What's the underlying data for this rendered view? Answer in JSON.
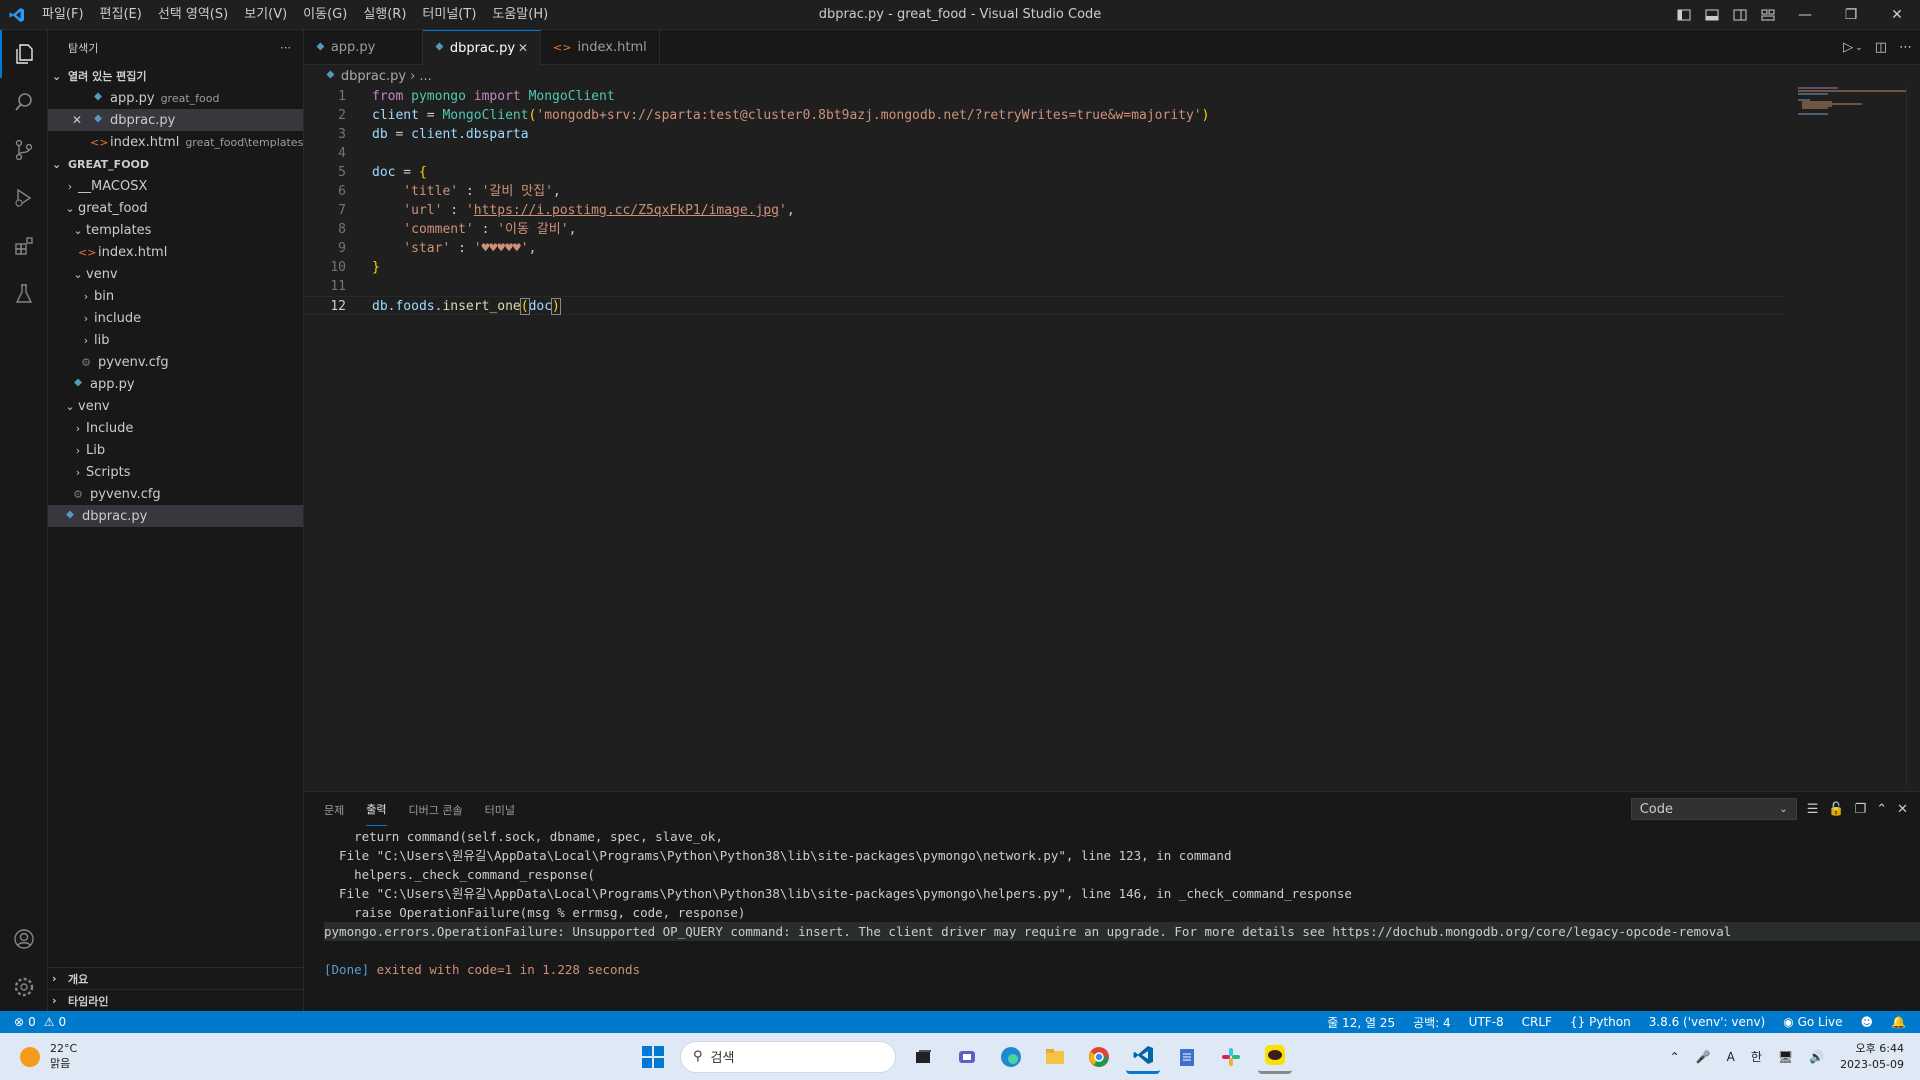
{
  "window": {
    "title": "dbprac.py - great_food - Visual Studio Code"
  },
  "menu": [
    "파일(F)",
    "편집(E)",
    "선택 영역(S)",
    "보기(V)",
    "이동(G)",
    "실행(R)",
    "터미널(T)",
    "도움말(H)"
  ],
  "sidebar": {
    "title": "탐색기",
    "open_editors_label": "열려 있는 편집기",
    "open_editors": [
      {
        "name": "app.py",
        "desc": "great_food"
      },
      {
        "name": "dbprac.py",
        "desc": ""
      },
      {
        "name": "index.html",
        "desc": "great_food\\templates"
      }
    ],
    "project_label": "GREAT_FOOD",
    "tree": [
      "__MACOSX",
      "great_food",
      "templates",
      "index.html",
      "venv",
      "bin",
      "include",
      "lib",
      "pyvenv.cfg",
      "app.py",
      "venv",
      "Include",
      "Lib",
      "Scripts",
      "pyvenv.cfg",
      "dbprac.py"
    ],
    "outline_label": "개요",
    "timeline_label": "타임라인"
  },
  "tabs": [
    {
      "label": "app.py"
    },
    {
      "label": "dbprac.py"
    },
    {
      "label": "index.html"
    }
  ],
  "breadcrumb": {
    "file": "dbprac.py",
    "rest": "..."
  },
  "code": {
    "lines": [
      "1",
      "2",
      "3",
      "4",
      "5",
      "6",
      "7",
      "8",
      "9",
      "10",
      "11",
      "12"
    ],
    "l1_a": "from ",
    "l1_b": "pymongo",
    "l1_c": " import ",
    "l1_d": "MongoClient",
    "l2_a": "client",
    "l2_b": " = ",
    "l2_c": "MongoClient",
    "l2_d": "(",
    "l2_e": "'mongodb+srv://sparta:test@cluster0.8bt9azj.mongodb.net/?retryWrites=true&w=majority'",
    "l2_f": ")",
    "l3_a": "db",
    "l3_b": " = ",
    "l3_c": "client",
    "l3_d": ".dbsparta",
    "l5_a": "doc",
    "l5_b": " = ",
    "l5_c": "{",
    "l6_a": "    'title'",
    "l6_b": " : ",
    "l6_c": "'갈비 맛집'",
    "l6_d": ",",
    "l7_a": "    'url'",
    "l7_b": " : ",
    "l7_c": "'",
    "l7_d": "https://i.postimg.cc/Z5qxFkP1/image.jpg",
    "l7_e": "'",
    "l7_f": ",",
    "l8_a": "    'comment'",
    "l8_b": " : ",
    "l8_c": "'이동 갈비'",
    "l8_d": ",",
    "l9_a": "    'star'",
    "l9_b": " : ",
    "l9_c": "'♥♥♥♥♥'",
    "l9_d": ",",
    "l10_a": "}",
    "l12_a": "db",
    "l12_b": ".foods.",
    "l12_c": "insert_one",
    "l12_d": "(",
    "l12_e": "doc",
    "l12_f": ")"
  },
  "panel": {
    "tabs": [
      "문제",
      "출력",
      "디버그 콘솔",
      "터미널"
    ],
    "select": "Code",
    "output": [
      "    return command(self.sock, dbname, spec, slave_ok,",
      "  File \"C:\\Users\\원유길\\AppData\\Local\\Programs\\Python\\Python38\\lib\\site-packages\\pymongo\\network.py\", line 123, in command",
      "    helpers._check_command_response(",
      "  File \"C:\\Users\\원유길\\AppData\\Local\\Programs\\Python\\Python38\\lib\\site-packages\\pymongo\\helpers.py\", line 146, in _check_command_response",
      "    raise OperationFailure(msg % errmsg, code, response)",
      "pymongo.errors.OperationFailure: Unsupported OP_QUERY command: insert. The client driver may require an upgrade. For more details see https://dochub.mongodb.org/core/legacy-opcode-removal",
      ""
    ],
    "done_a": "[Done]",
    "done_b": " exited with ",
    "done_c": "code=1",
    "done_d": " in ",
    "done_e": "1.228",
    "done_f": " seconds"
  },
  "status": {
    "errors": "0",
    "warnings": "0",
    "position": "줄 12, 열 25",
    "spaces": "공백: 4",
    "encoding": "UTF-8",
    "eol": "CRLF",
    "language": "Python",
    "interpreter": "3.8.6 ('venv': venv)",
    "golive": "Go Live"
  },
  "taskbar": {
    "temp": "22°C",
    "weather": "맑음",
    "search": "검색",
    "ime1": "A",
    "ime2": "한",
    "time": "오후 6:44",
    "date": "2023-05-09"
  },
  "colors": {
    "accent": "#007acc",
    "tab_border": "#0078d4"
  }
}
